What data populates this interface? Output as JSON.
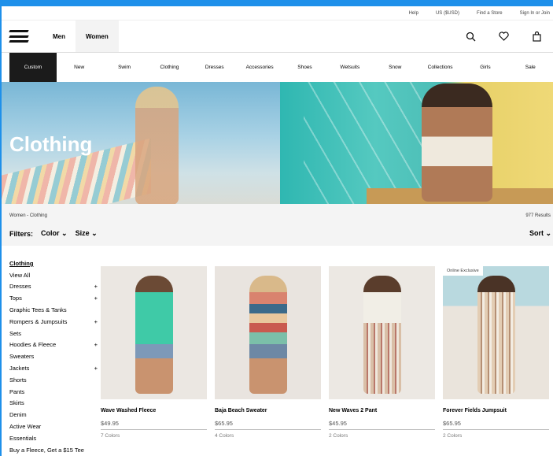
{
  "utility": {
    "help": "Help",
    "currency": "US ($USD)",
    "store": "Find a Store",
    "signin": "Sign In or Join"
  },
  "nav": {
    "men": "Men",
    "women": "Women"
  },
  "categories": [
    "Custom",
    "New",
    "Swim",
    "Clothing",
    "Dresses",
    "Accessories",
    "Shoes",
    "Wetsuits",
    "Snow",
    "Collections",
    "Girls",
    "Sale"
  ],
  "hero": {
    "title": "Clothing"
  },
  "breadcrumb": "Women - Clothing",
  "results": "977 Results",
  "filters": {
    "label": "Filters:",
    "color": "Color",
    "size": "Size",
    "sort": "Sort"
  },
  "sidebar": [
    {
      "label": "Clothing",
      "plus": ""
    },
    {
      "label": "View All",
      "plus": ""
    },
    {
      "label": "Dresses",
      "plus": "+"
    },
    {
      "label": "Tops",
      "plus": "+"
    },
    {
      "label": "Graphic Tees & Tanks",
      "plus": ""
    },
    {
      "label": "Rompers & Jumpsuits",
      "plus": "+"
    },
    {
      "label": "Sets",
      "plus": ""
    },
    {
      "label": "Hoodies & Fleece",
      "plus": "+"
    },
    {
      "label": "Sweaters",
      "plus": ""
    },
    {
      "label": "Jackets",
      "plus": "+"
    },
    {
      "label": "Shorts",
      "plus": ""
    },
    {
      "label": "Pants",
      "plus": ""
    },
    {
      "label": "Skirts",
      "plus": ""
    },
    {
      "label": "Denim",
      "plus": ""
    },
    {
      "label": "Active Wear",
      "plus": ""
    },
    {
      "label": "Essentials",
      "plus": ""
    },
    {
      "label": "Buy a Fleece, Get a $15 Tee",
      "plus": ""
    }
  ],
  "products": [
    {
      "name": "Wave Washed Fleece",
      "price": "$49.95",
      "colors": "7 Colors",
      "badge": "",
      "bg": "#ebe7e2",
      "color": "#3fcaa7"
    },
    {
      "name": "Baja Beach Sweater",
      "price": "$65.95",
      "colors": "4 Colors",
      "badge": "",
      "bg": "#e9e4df",
      "color": "#d9836e"
    },
    {
      "name": "New Waves 2 Pant",
      "price": "$45.95",
      "colors": "2 Colors",
      "badge": "",
      "bg": "#ece8e3",
      "color": "#d9bfa7"
    },
    {
      "name": "Forever Fields Jumpsuit",
      "price": "$65.95",
      "colors": "2 Colors",
      "badge": "Online Exclusive",
      "bg": "#b9d9df",
      "color": "#e3cdb4"
    }
  ]
}
